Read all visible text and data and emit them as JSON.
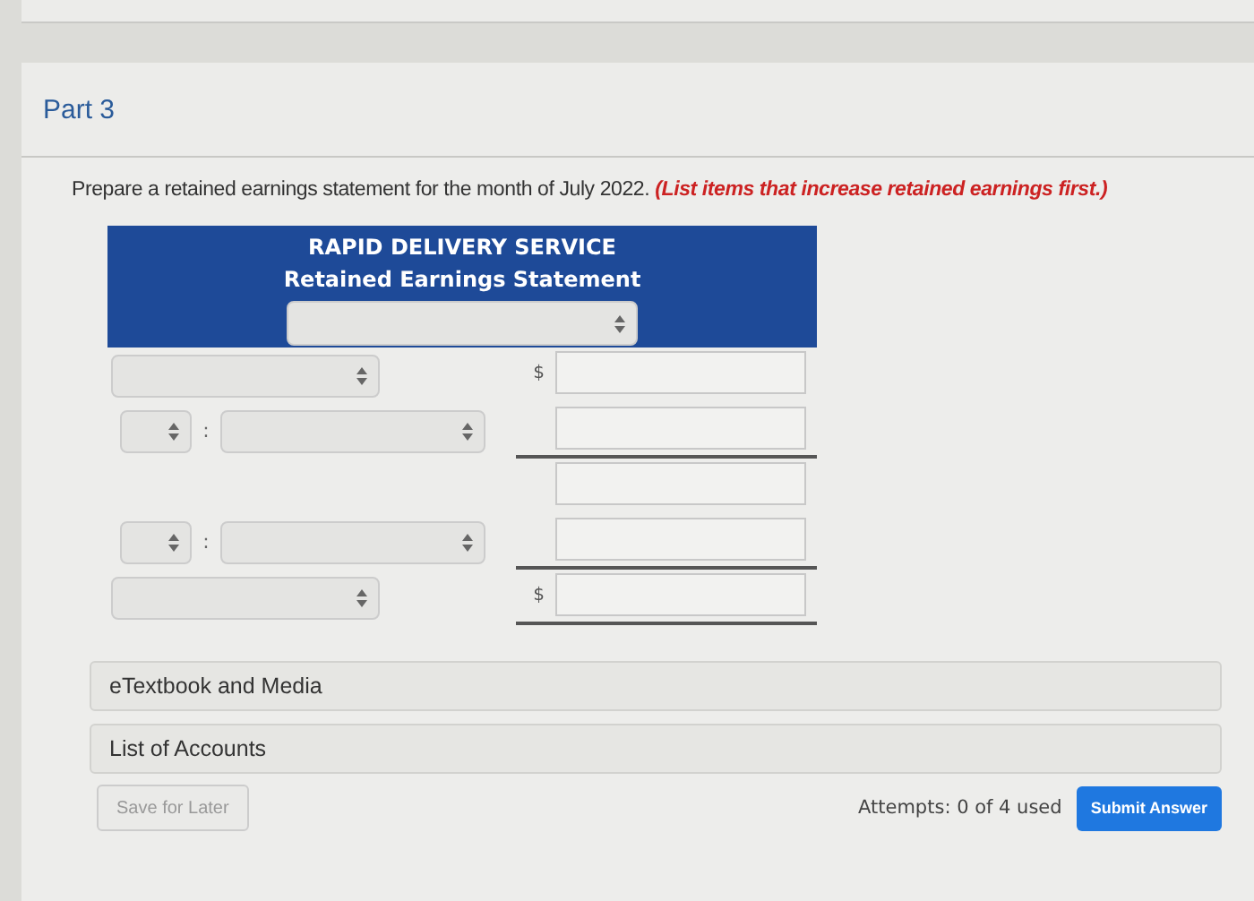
{
  "part": {
    "title": "Part 3"
  },
  "instruction": {
    "text": "Prepare a retained earnings statement for the month of July 2022. ",
    "hint": "(List items that increase retained earnings first.)"
  },
  "statement": {
    "company": "RAPID DELIVERY SERVICE",
    "title": "Retained Earnings Statement",
    "rows": [
      {
        "kind": "item",
        "currency": "$",
        "rule": false
      },
      {
        "kind": "operator",
        "separator": ":",
        "rule": true
      },
      {
        "kind": "amount",
        "rule": false
      },
      {
        "kind": "operator",
        "separator": ":",
        "rule": true
      },
      {
        "kind": "item",
        "currency": "$",
        "rule": true
      }
    ]
  },
  "resources": [
    "eTextbook and Media",
    "List of Accounts"
  ],
  "footer": {
    "save": "Save for Later",
    "attempts": "Attempts: 0 of 4 used",
    "submit": "Submit Answer"
  }
}
